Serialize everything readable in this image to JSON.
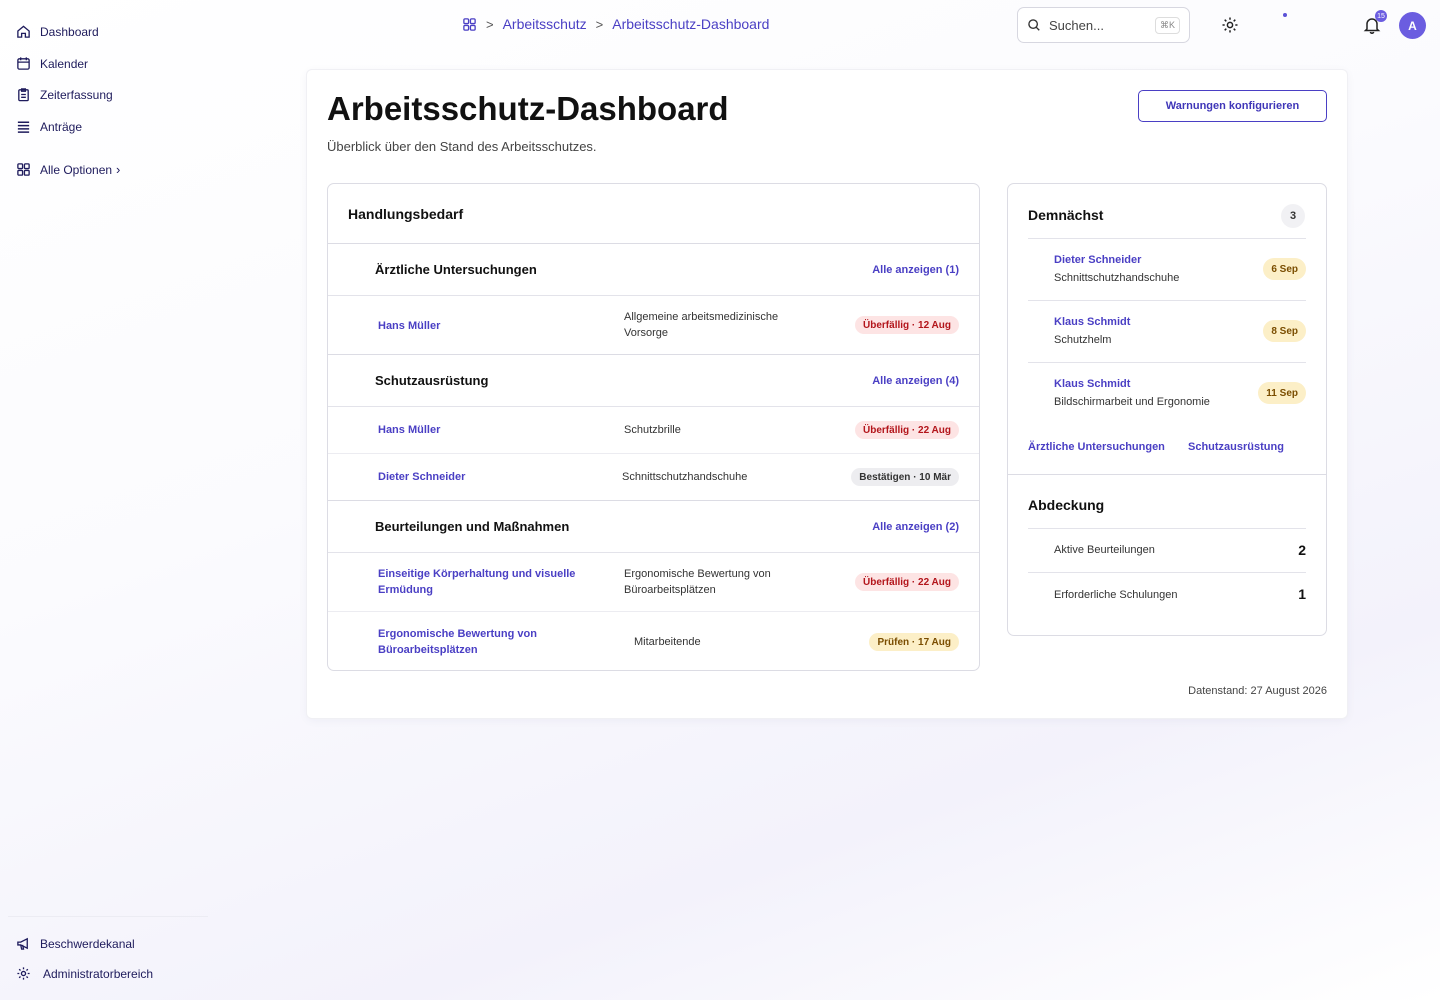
{
  "sidebar": {
    "items": [
      {
        "label": "Dashboard"
      },
      {
        "label": "Kalender"
      },
      {
        "label": "Zeiterfassung"
      },
      {
        "label": "Anträge"
      }
    ],
    "more_label": "Alle Optionen",
    "more_chevron": "›",
    "bottom": [
      {
        "label": "Beschwerdekanal"
      },
      {
        "label": "Administratorbereich"
      }
    ]
  },
  "breadcrumb": {
    "items": [
      "Arbeitsschutz",
      "Arbeitsschutz-Dashboard"
    ],
    "separator": ">"
  },
  "search": {
    "placeholder": "Suchen...",
    "shortcut": "⌘K"
  },
  "notifications": {
    "count": "15"
  },
  "user": {
    "initial": "A"
  },
  "page": {
    "title": "Arbeitsschutz-Dashboard",
    "subtitle": "Überblick über den Stand des Arbeitsschutzes.",
    "config_button": "Warnungen konfigurieren",
    "data_stamp": "Datenstand: 27 August 2026"
  },
  "action_panel": {
    "title": "Handlungsbedarf",
    "sections": [
      {
        "title": "Ärztliche Untersuchungen",
        "link": "Alle anzeigen (1)",
        "rows": [
          {
            "name": "Hans Müller",
            "desc": "Allgemeine arbeitsmedizinische Vorsorge",
            "status": "Überfällig · 12 Aug",
            "tone": "red"
          }
        ]
      },
      {
        "title": "Schutzausrüstung",
        "link": "Alle anzeigen (4)",
        "rows": [
          {
            "name": "Hans Müller",
            "desc": "Schutzbrille",
            "status": "Überfällig · 22 Aug",
            "tone": "red"
          },
          {
            "name": "Dieter Schneider",
            "desc": "Schnittschutzhandschuhe",
            "status": "Bestätigen · 10 Mär",
            "tone": "gray"
          }
        ]
      },
      {
        "title": "Beurteilungen und Maßnahmen",
        "link": "Alle anzeigen (2)",
        "rows": [
          {
            "name": "Einseitige Körperhaltung und visuelle Ermüdung",
            "desc": "Ergonomische Bewertung von Büroarbeitsplätzen",
            "status": "Überfällig · 22 Aug",
            "tone": "red"
          },
          {
            "name": "Ergonomische Bewertung von Büroarbeitsplätzen",
            "desc": "Mitarbeitende",
            "status": "Prüfen · 17 Aug",
            "tone": "yellow"
          }
        ]
      }
    ]
  },
  "upcoming": {
    "title": "Demnächst",
    "count": "3",
    "items": [
      {
        "name": "Dieter Schneider",
        "desc": "Schnittschutzhandschuhe",
        "date": "6 Sep"
      },
      {
        "name": "Klaus Schmidt",
        "desc": "Schutzhelm",
        "date": "8 Sep"
      },
      {
        "name": "Klaus Schmidt",
        "desc": "Bildschirmarbeit und Ergonomie",
        "date": "11 Sep"
      }
    ],
    "filters": [
      "Ärztliche Untersuchungen",
      "Schutzausrüstung"
    ]
  },
  "coverage": {
    "title": "Abdeckung",
    "items": [
      {
        "label": "Aktive Beurteilungen",
        "value": "2"
      },
      {
        "label": "Erforderliche Schulungen",
        "value": "1"
      }
    ]
  },
  "colors": {
    "accent": "#4a3fc4",
    "overdue": "#b3151b",
    "review": "#7a4d00"
  }
}
